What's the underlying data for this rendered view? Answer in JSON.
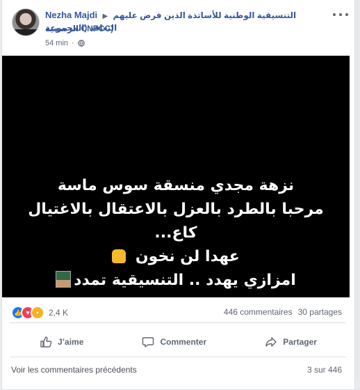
{
  "post": {
    "author": "Nezha Majdi",
    "group_name": "التنسيقية الوطنية للأساتذة الذين فرض عليهم التعاقد (المجموعة",
    "group_name_line2": "الرسمية CNPCC)",
    "time": "54 min"
  },
  "image_text": {
    "line1": "نزهة مجدي منسقة سوس ماسة",
    "line2": "مرحبا بالطرد بالعزل بالاعتقال بالاغتيال",
    "line3": "كاع...",
    "line4": "عهدا لن نخون",
    "line5": "امزازي يهدد .. التنسيقية تمدد"
  },
  "engagement": {
    "reaction_count": "2,4 K",
    "comments": "446 commentaires",
    "shares": "30 partages"
  },
  "actions": {
    "like": "J’aime",
    "comment": "Commenter",
    "share": "Partager"
  },
  "comments": {
    "view_previous": "Voir les commentaires précédents",
    "count": "3 sur 446"
  }
}
